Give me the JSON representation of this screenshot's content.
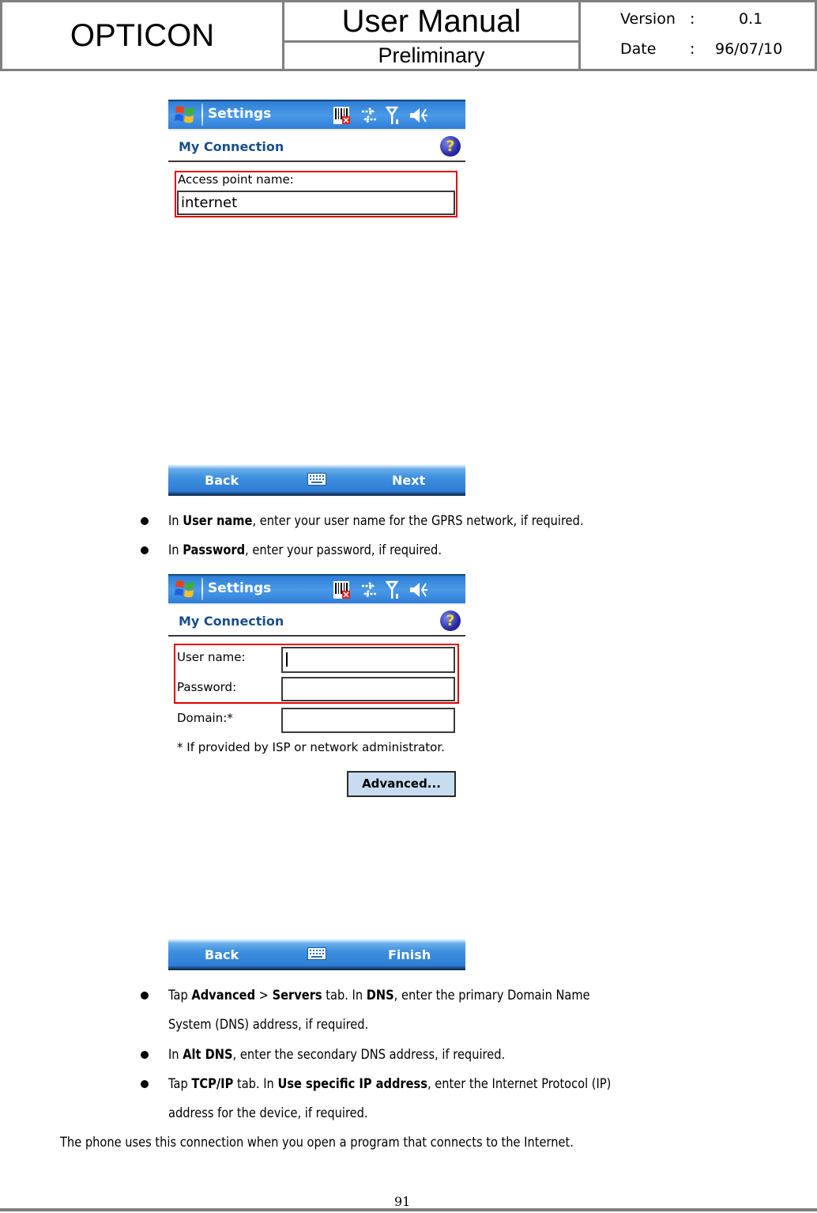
{
  "header": {
    "brand": "OPTICON",
    "title": "User Manual",
    "subtitle": "Preliminary",
    "version_label": "Version",
    "version_sep": ":",
    "version_value": "0.1",
    "date_label": "Date",
    "date_sep": ":",
    "date_value": "96/07/10"
  },
  "phone_common": {
    "app_title": "Settings",
    "heading": "My Connection",
    "help_glyph": "?",
    "status_icons": [
      "barcode-scanner-off-icon",
      "connectivity-arrows-icon",
      "signal-antenna-icon",
      "speaker-volume-icon"
    ],
    "softkey_left": "Back"
  },
  "screen1": {
    "access_point_label": "Access point name:",
    "access_point_value": "internet",
    "softkey_right": "Next",
    "highlight_color": "#e00000"
  },
  "bullets_1": [
    {
      "prefix": "In ",
      "bold": "User name",
      "suffix": ", enter your user name for the GPRS network, if required."
    },
    {
      "prefix": "In ",
      "bold": "Password",
      "suffix": ", enter your password, if required."
    }
  ],
  "screen2": {
    "user_name_label": "User name:",
    "user_name_value": "",
    "password_label": "Password:",
    "password_value": "",
    "domain_label": "Domain:*",
    "domain_value": "",
    "footnote": "* If provided by ISP or network administrator.",
    "advanced_button": "Advanced...",
    "softkey_right": "Finish"
  },
  "bullets_2": {
    "b1_t1": "Tap ",
    "b1_bold1": "Advanced",
    "b1_t2": " > ",
    "b1_bold2": "Servers",
    "b1_t3": " tab. In ",
    "b1_bold3": "DNS",
    "b1_t4": ", enter the primary Domain Name",
    "b1_line2": "System (DNS) address, if required.",
    "b2_t1": "In ",
    "b2_bold1": "Alt DNS",
    "b2_t2": ", enter the secondary DNS address, if required.",
    "b3_t1": "Tap ",
    "b3_bold1": "TCP/IP",
    "b3_t2": " tab. In ",
    "b3_bold2": "Use specific IP address",
    "b3_t3": ", enter the Internet Protocol (IP)",
    "b3_line2": "address for the device, if required."
  },
  "closing": "The phone uses this connection when you open a program that connects to the Internet.",
  "page_number": "91"
}
